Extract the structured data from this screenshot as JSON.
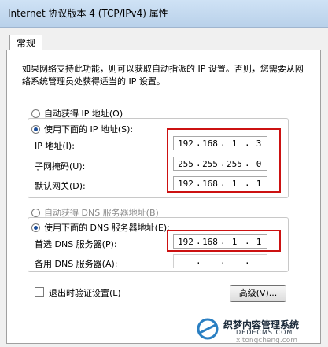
{
  "window": {
    "title": "Internet 协议版本 4 (TCP/IPv4) 属性"
  },
  "tabs": [
    {
      "label": "常规"
    }
  ],
  "description": "如果网络支持此功能，则可以获取自动指派的 IP 设置。否则，您需要从网络系统管理员处获得适当的 IP 设置。",
  "ip_section": {
    "auto_label": "自动获得 IP 地址(O)",
    "manual_label": "使用下面的 IP 地址(S):",
    "ip_label": "IP 地址(I):",
    "ip_value": [
      "192",
      "168",
      "1",
      "3"
    ],
    "mask_label": "子网掩码(U):",
    "mask_value": [
      "255",
      "255",
      "255",
      "0"
    ],
    "gateway_label": "默认网关(D):",
    "gateway_value": [
      "192",
      "168",
      "1",
      "1"
    ]
  },
  "dns_section": {
    "auto_label": "自动获得 DNS 服务器地址(B)",
    "manual_label": "使用下面的 DNS 服务器地址(E):",
    "preferred_label": "首选 DNS 服务器(P):",
    "preferred_value": [
      "192",
      "168",
      "1",
      "1"
    ],
    "alternate_label": "备用 DNS 服务器(A):",
    "alternate_value": [
      ".",
      ".",
      "."
    ]
  },
  "validate_label": "退出时验证设置(L)",
  "advanced_label": "高级(V)...",
  "watermark": {
    "line1": "织梦内容管理系统",
    "line2": "DEDECMS.COM",
    "line3": "xitongcheng.com"
  },
  "colors": {
    "highlight_box": "#cc1111"
  }
}
